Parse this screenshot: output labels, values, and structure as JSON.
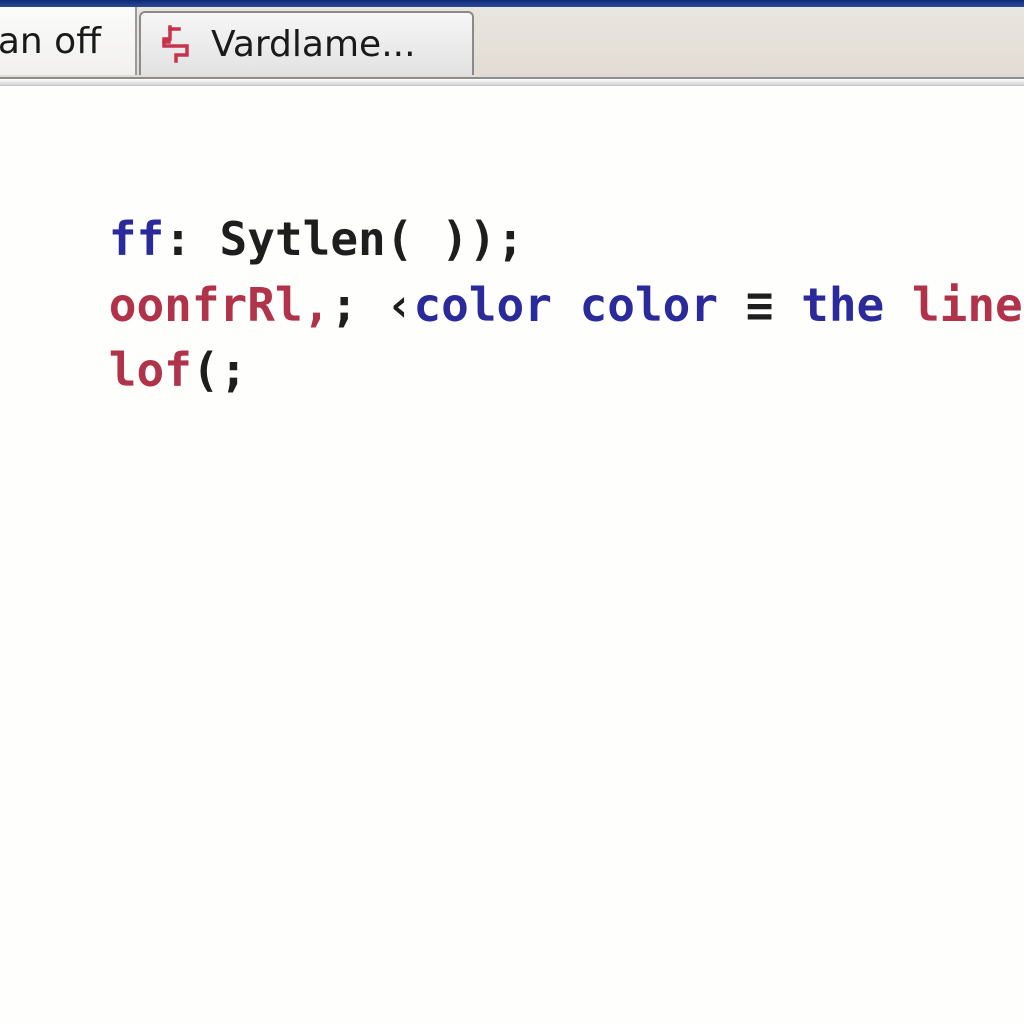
{
  "window": {
    "accent_color": "#0c2a78"
  },
  "tabs": [
    {
      "label": "an off",
      "active": true
    },
    {
      "label": "Vardlame...",
      "active": false,
      "icon": "red-glyph-icon",
      "icon_color": "#c8324a"
    }
  ],
  "editor": {
    "lines": [
      [
        {
          "text": "ff",
          "role": "keyword"
        },
        {
          "text": ": Sytlen( ));",
          "role": "plain"
        }
      ],
      [
        {
          "text": "oonfrRl,",
          "role": "string"
        },
        {
          "text": "; ",
          "role": "plain"
        },
        {
          "text": "‹",
          "role": "plain"
        },
        {
          "text": "color color",
          "role": "keyword"
        },
        {
          "text": " ≡ ",
          "role": "plain"
        },
        {
          "text": "the",
          "role": "keyword"
        },
        {
          "text": " linesfe",
          "role": "string"
        }
      ],
      [
        {
          "text": "lof",
          "role": "string"
        },
        {
          "text": "(;",
          "role": "plain"
        }
      ]
    ],
    "colors": {
      "keyword": "#2a2a9a",
      "string": "#b0334a",
      "plain": "#1e1e1e"
    }
  }
}
